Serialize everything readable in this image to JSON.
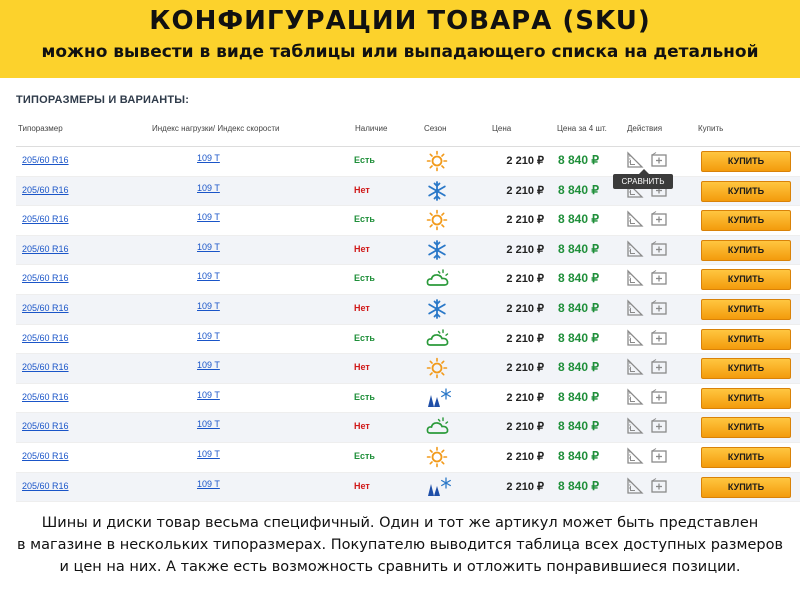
{
  "banner": {
    "title": "КОНФИГУРАЦИИ ТОВАРА (SKU)",
    "subtitle": "можно вывести в виде таблицы или выпадающего списка на детальной"
  },
  "section_title": "ТИПОРАЗМЕРЫ И ВАРИАНТЫ:",
  "columns": {
    "size": "Типоразмер",
    "index": "Индекс нагрузки/ Индекс скорости",
    "availability": "Наличие",
    "season": "Сезон",
    "price": "Цена",
    "price4": "Цена за 4 шт.",
    "actions": "Действия",
    "buy": "Купить"
  },
  "tooltip": "СРАВНИТЬ",
  "rows": [
    {
      "size": "205/60 R16",
      "index": "109 T",
      "availability": "Есть",
      "in_stock": true,
      "season": "summer-icon",
      "price": "2 210 ₽",
      "price4": "8 840 ₽",
      "buy": "КУПИТЬ"
    },
    {
      "size": "205/60 R16",
      "index": "109 T",
      "availability": "Нет",
      "in_stock": false,
      "season": "winter-icon",
      "price": "2 210 ₽",
      "price4": "8 840 ₽",
      "buy": "КУПИТЬ"
    },
    {
      "size": "205/60 R16",
      "index": "109 T",
      "availability": "Есть",
      "in_stock": true,
      "season": "summer-icon",
      "price": "2 210 ₽",
      "price4": "8 840 ₽",
      "buy": "КУПИТЬ"
    },
    {
      "size": "205/60 R16",
      "index": "109 T",
      "availability": "Нет",
      "in_stock": false,
      "season": "winter-icon",
      "price": "2 210 ₽",
      "price4": "8 840 ₽",
      "buy": "КУПИТЬ"
    },
    {
      "size": "205/60 R16",
      "index": "109 T",
      "availability": "Есть",
      "in_stock": true,
      "season": "all-season-icon",
      "price": "2 210 ₽",
      "price4": "8 840 ₽",
      "buy": "КУПИТЬ"
    },
    {
      "size": "205/60 R16",
      "index": "109 T",
      "availability": "Нет",
      "in_stock": false,
      "season": "winter-icon",
      "price": "2 210 ₽",
      "price4": "8 840 ₽",
      "buy": "КУПИТЬ"
    },
    {
      "size": "205/60 R16",
      "index": "109 T",
      "availability": "Есть",
      "in_stock": true,
      "season": "all-season-icon",
      "price": "2 210 ₽",
      "price4": "8 840 ₽",
      "buy": "КУПИТЬ"
    },
    {
      "size": "205/60 R16",
      "index": "109 T",
      "availability": "Нет",
      "in_stock": false,
      "season": "summer-icon",
      "price": "2 210 ₽",
      "price4": "8 840 ₽",
      "buy": "КУПИТЬ"
    },
    {
      "size": "205/60 R16",
      "index": "109 T",
      "availability": "Есть",
      "in_stock": true,
      "season": "studded-winter-icon",
      "price": "2 210 ₽",
      "price4": "8 840 ₽",
      "buy": "КУПИТЬ"
    },
    {
      "size": "205/60 R16",
      "index": "109 T",
      "availability": "Нет",
      "in_stock": false,
      "season": "all-season-icon",
      "price": "2 210 ₽",
      "price4": "8 840 ₽",
      "buy": "КУПИТЬ"
    },
    {
      "size": "205/60 R16",
      "index": "109 T",
      "availability": "Есть",
      "in_stock": true,
      "season": "summer-icon",
      "price": "2 210 ₽",
      "price4": "8 840 ₽",
      "buy": "КУПИТЬ"
    },
    {
      "size": "205/60 R16",
      "index": "109 T",
      "availability": "Нет",
      "in_stock": false,
      "season": "studded-winter-icon",
      "price": "2 210 ₽",
      "price4": "8 840 ₽",
      "buy": "КУПИТЬ"
    }
  ],
  "footer": {
    "line1": "Шины и диски товар весьма специфичный. Один и тот же артикул может быть представлен",
    "line2": "в магазине в нескольких типоразмерах. Покупателю выводится таблица всех доступных размеров",
    "line3": "и цен на них. А также есть возможность сравнить и отложить понравившиеся позиции."
  },
  "colors": {
    "banner": "#fcd22c",
    "in_stock": "#1f8f3a",
    "out_of_stock": "#d01818",
    "link": "#1a55c8",
    "buy_button": "#f7a91e",
    "row_alt": "#f2f4f8"
  }
}
